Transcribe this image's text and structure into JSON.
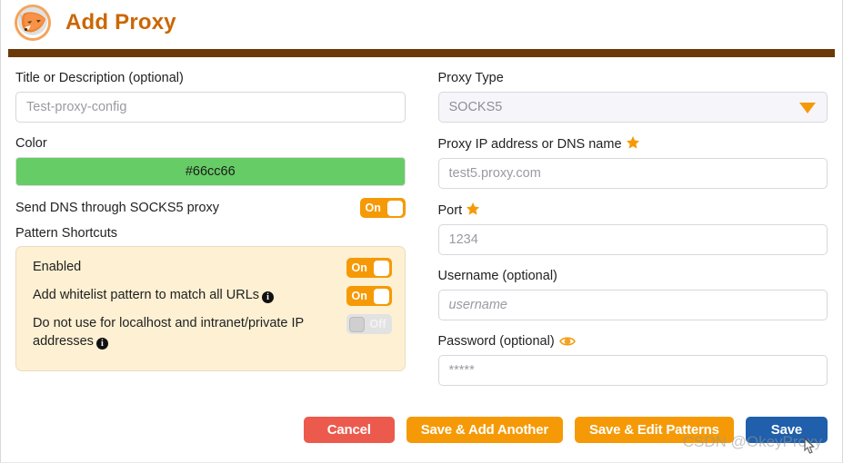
{
  "header": {
    "title": "Add Proxy",
    "logo_icon": "fox-logo-icon",
    "bar_color": "#6b3908",
    "title_color": "#cc6600"
  },
  "left": {
    "title_label": "Title or Description (optional)",
    "title_value": "Test-proxy-config",
    "color_label": "Color",
    "color_value": "#66cc66",
    "dns_label": "Send DNS through SOCKS5 proxy",
    "dns_toggle": "On",
    "patterns_label": "Pattern Shortcuts",
    "panel": {
      "rows": [
        {
          "text": "Enabled",
          "info": false,
          "toggle": "On",
          "state": "on"
        },
        {
          "text": "Add whitelist pattern to match all URLs",
          "info": true,
          "toggle": "On",
          "state": "on"
        },
        {
          "text": "Do not use for localhost and intranet/private IP addresses",
          "info": true,
          "toggle": "Off",
          "state": "off"
        }
      ]
    }
  },
  "right": {
    "proxy_type_label": "Proxy Type",
    "proxy_type_value": "SOCKS5",
    "proxy_type_arrow_icon": "chevron-down-icon",
    "host_label": "Proxy IP address or DNS name",
    "host_required_icon": "star-icon",
    "host_value": "test5.proxy.com",
    "port_label": "Port",
    "port_required_icon": "star-icon",
    "port_value": "1234",
    "username_label": "Username (optional)",
    "username_value": "username",
    "password_label": "Password (optional)",
    "password_reveal_icon": "eye-icon",
    "password_value": "*****"
  },
  "buttons": {
    "cancel": "Cancel",
    "save_add_another": "Save & Add Another",
    "save_edit_patterns": "Save & Edit Patterns",
    "save": "Save",
    "colors": {
      "cancel": "#ec5a4d",
      "orange": "#f59a06",
      "save": "#1f5fab"
    }
  },
  "watermark": {
    "text": "CSDN @OkeyProxy"
  }
}
